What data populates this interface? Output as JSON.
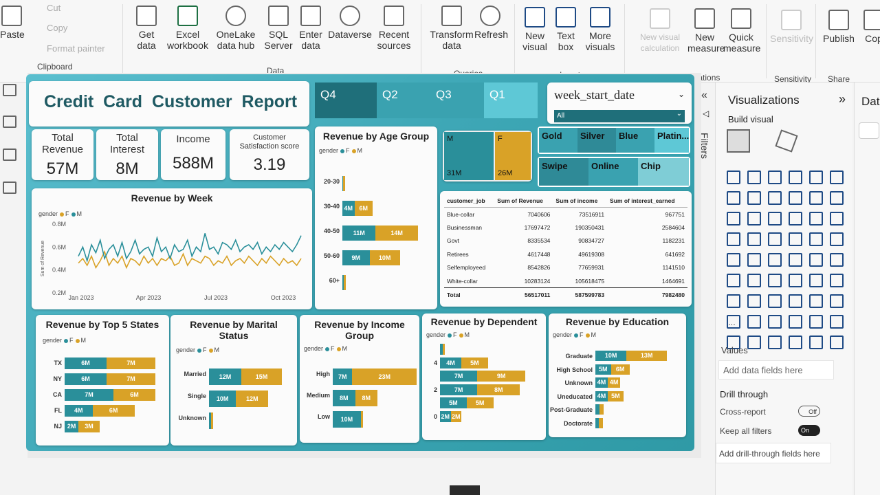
{
  "ribbon": {
    "clipboard": {
      "paste": "Paste",
      "cut": "Cut",
      "copy": "Copy",
      "format_painter": "Format painter",
      "group": "Clipboard"
    },
    "data": {
      "get_data": "Get data",
      "excel": "Excel workbook",
      "onelake": "OneLake data hub",
      "sql": "SQL Server",
      "enter": "Enter data",
      "dataverse": "Dataverse",
      "recent": "Recent sources",
      "group": "Data"
    },
    "queries": {
      "transform": "Transform data",
      "refresh": "Refresh",
      "group": "Queries"
    },
    "insert": {
      "new_visual": "New visual",
      "text_box": "Text box",
      "more_visuals": "More visuals",
      "group": "Insert"
    },
    "calculations": {
      "new_visual_calc": "New visual calculation",
      "new_measure": "New measure",
      "quick_measure": "Quick measure",
      "group": "Calculations"
    },
    "sensitivity": {
      "label": "Sensitivity",
      "group": "Sensitivity"
    },
    "share": {
      "publish": "Publish",
      "group": "Share"
    },
    "copilot": "Cop"
  },
  "report": {
    "title": "Credit  Card  Customer  Report",
    "quarters": [
      "Q4",
      "Q2",
      "Q3",
      "Q1"
    ],
    "week_slicer": {
      "label": "week_start_date",
      "value": "All"
    },
    "gender_tree": {
      "m": "M",
      "f": "F",
      "m_val": "31M",
      "f_val": "26M"
    },
    "card_category": [
      "Gold",
      "Silver",
      "Blue",
      "Platin..."
    ],
    "use_chip": [
      "Swipe",
      "Online",
      "Chip"
    ],
    "kpis": [
      {
        "label": "Total Revenue",
        "value": "57M"
      },
      {
        "label": "Total Interest",
        "value": "8M"
      },
      {
        "label": "Income",
        "value": "588M"
      },
      {
        "label": "Customer Satisfaction score",
        "value": "3.19"
      }
    ],
    "legend": {
      "title": "gender",
      "f": "F",
      "m": "M"
    }
  },
  "chart_data": [
    {
      "type": "line",
      "title": "Revenue by Week",
      "ylabel": "Sum of Revenue",
      "x_ticks": [
        "Jan 2023",
        "Apr 2023",
        "Jul 2023",
        "Oct 2023"
      ],
      "y_ticks": [
        "0.2M",
        "0.4M",
        "0.6M",
        "0.8M"
      ],
      "ylim": [
        0.2,
        0.8
      ],
      "series": [
        {
          "name": "F",
          "values": [
            0.52,
            0.6,
            0.48,
            0.62,
            0.55,
            0.66,
            0.5,
            0.58,
            0.62,
            0.52,
            0.64,
            0.5,
            0.56,
            0.66,
            0.54,
            0.58,
            0.6,
            0.52,
            0.68,
            0.56,
            0.6,
            0.5,
            0.62,
            0.56,
            0.58,
            0.66,
            0.52,
            0.6,
            0.56,
            0.72,
            0.58,
            0.6,
            0.54,
            0.64,
            0.62,
            0.58,
            0.66,
            0.56,
            0.6,
            0.62,
            0.58,
            0.64,
            0.54,
            0.6,
            0.56,
            0.62,
            0.58,
            0.64,
            0.6,
            0.56,
            0.62,
            0.7
          ]
        },
        {
          "name": "M",
          "values": [
            0.46,
            0.5,
            0.44,
            0.52,
            0.42,
            0.48,
            0.56,
            0.44,
            0.5,
            0.46,
            0.52,
            0.42,
            0.5,
            0.48,
            0.44,
            0.52,
            0.46,
            0.5,
            0.44,
            0.5,
            0.48,
            0.52,
            0.44,
            0.46,
            0.54,
            0.44,
            0.5,
            0.48,
            0.46,
            0.52,
            0.5,
            0.44,
            0.48,
            0.46,
            0.52,
            0.44,
            0.48,
            0.5,
            0.46,
            0.52,
            0.48,
            0.44,
            0.5,
            0.46,
            0.52,
            0.48,
            0.44,
            0.5,
            0.46,
            0.48,
            0.44,
            0.5
          ]
        }
      ]
    },
    {
      "type": "bar",
      "title": "Revenue by Age Group",
      "categories": [
        "20-30",
        "30-40",
        "40-50",
        "50-60",
        "60+"
      ],
      "series": [
        {
          "name": "F",
          "values": [
            0.15,
            4,
            11,
            9,
            0.5
          ]
        },
        {
          "name": "M",
          "values": [
            0.15,
            6,
            14,
            10,
            0.6
          ]
        }
      ],
      "labels": [
        [
          "",
          ""
        ],
        [
          "4M",
          "6M"
        ],
        [
          "11M",
          "14M"
        ],
        [
          "9M",
          "10M"
        ],
        [
          "",
          ""
        ]
      ]
    },
    {
      "type": "bar",
      "title": "Revenue by Top 5 States",
      "categories": [
        "TX",
        "NY",
        "CA",
        "FL",
        "NJ"
      ],
      "series": [
        {
          "name": "F",
          "values": [
            6,
            6,
            7,
            4,
            2
          ]
        },
        {
          "name": "M",
          "values": [
            7,
            7,
            6,
            6,
            3
          ]
        }
      ],
      "labels": [
        [
          "6M",
          "7M"
        ],
        [
          "6M",
          "7M"
        ],
        [
          "7M",
          "6M"
        ],
        [
          "4M",
          "6M"
        ],
        [
          "2M",
          "3M"
        ]
      ]
    },
    {
      "type": "bar",
      "title": "Revenue by Marital Status",
      "categories": [
        "Married",
        "Single",
        "Unknown"
      ],
      "series": [
        {
          "name": "F",
          "values": [
            12,
            10,
            0.7
          ]
        },
        {
          "name": "M",
          "values": [
            15,
            12,
            0.4
          ]
        }
      ],
      "labels": [
        [
          "12M",
          "15M"
        ],
        [
          "10M",
          "12M"
        ],
        [
          "",
          ""
        ]
      ]
    },
    {
      "type": "bar",
      "title": "Revenue by Income Group",
      "categories": [
        "High",
        "Medium",
        "Low"
      ],
      "series": [
        {
          "name": "F",
          "values": [
            7,
            8,
            10
          ]
        },
        {
          "name": "M",
          "values": [
            23,
            8,
            0.6
          ]
        }
      ],
      "labels": [
        [
          "7M",
          "23M"
        ],
        [
          "8M",
          "8M"
        ],
        [
          "10M",
          ""
        ]
      ]
    },
    {
      "type": "bar",
      "title": "Revenue by Dependent",
      "categories": [
        "",
        "4",
        "",
        "2",
        "",
        ""
      ],
      "axis_labels": [
        "",
        "4",
        "",
        "2",
        "",
        "0"
      ],
      "series": [
        {
          "name": "F",
          "values": [
            0.5,
            4,
            7,
            7,
            5,
            2
          ]
        },
        {
          "name": "M",
          "values": [
            0.3,
            5,
            9,
            8,
            5,
            2
          ]
        }
      ],
      "labels": [
        [
          "",
          ""
        ],
        [
          "4M",
          "5M"
        ],
        [
          "7M",
          "9M"
        ],
        [
          "7M",
          "8M"
        ],
        [
          "5M",
          "5M"
        ],
        [
          "2M",
          "2M"
        ]
      ]
    },
    {
      "type": "bar",
      "title": "Revenue by Education",
      "categories": [
        "Graduate",
        "High School",
        "Unknown",
        "Uneducated",
        "Post-Graduate",
        "Doctorate"
      ],
      "series": [
        {
          "name": "F",
          "values": [
            10,
            5,
            4,
            4,
            1.3,
            1.2
          ]
        },
        {
          "name": "M",
          "values": [
            13,
            6,
            4,
            5,
            1.3,
            1.2
          ]
        }
      ],
      "labels": [
        [
          "10M",
          "13M"
        ],
        [
          "5M",
          "6M"
        ],
        [
          "4M",
          "4M"
        ],
        [
          "4M",
          "5M"
        ],
        [
          "",
          ""
        ],
        [
          "",
          ""
        ]
      ]
    },
    {
      "type": "table",
      "columns": [
        "customer_job",
        "Sum of Revenue",
        "Sum of income",
        "Sum of interest_earned"
      ],
      "rows": [
        [
          "Blue-collar",
          "7040606",
          "73516911",
          "967751"
        ],
        [
          "Businessman",
          "17697472",
          "190350431",
          "2584604"
        ],
        [
          "Govt",
          "8335534",
          "90834727",
          "1182231"
        ],
        [
          "Retirees",
          "4617448",
          "49619308",
          "641692"
        ],
        [
          "Selfemployeed",
          "8542826",
          "77659931",
          "1141510"
        ],
        [
          "White-collar",
          "10283124",
          "105618475",
          "1464691"
        ]
      ],
      "total": [
        "Total",
        "56517011",
        "587599783",
        "7982480"
      ]
    }
  ],
  "panes": {
    "filters": "Filters",
    "visualizations": "Visualizations",
    "build_visual": "Build visual",
    "values": "Values",
    "add_data": "Add data fields here",
    "drill_through": "Drill through",
    "cross_report": "Cross-report",
    "cross_report_state": "Off",
    "keep_filters": "Keep all filters",
    "keep_filters_state": "On",
    "add_drill": "Add drill-through fields here",
    "data": "Data"
  }
}
